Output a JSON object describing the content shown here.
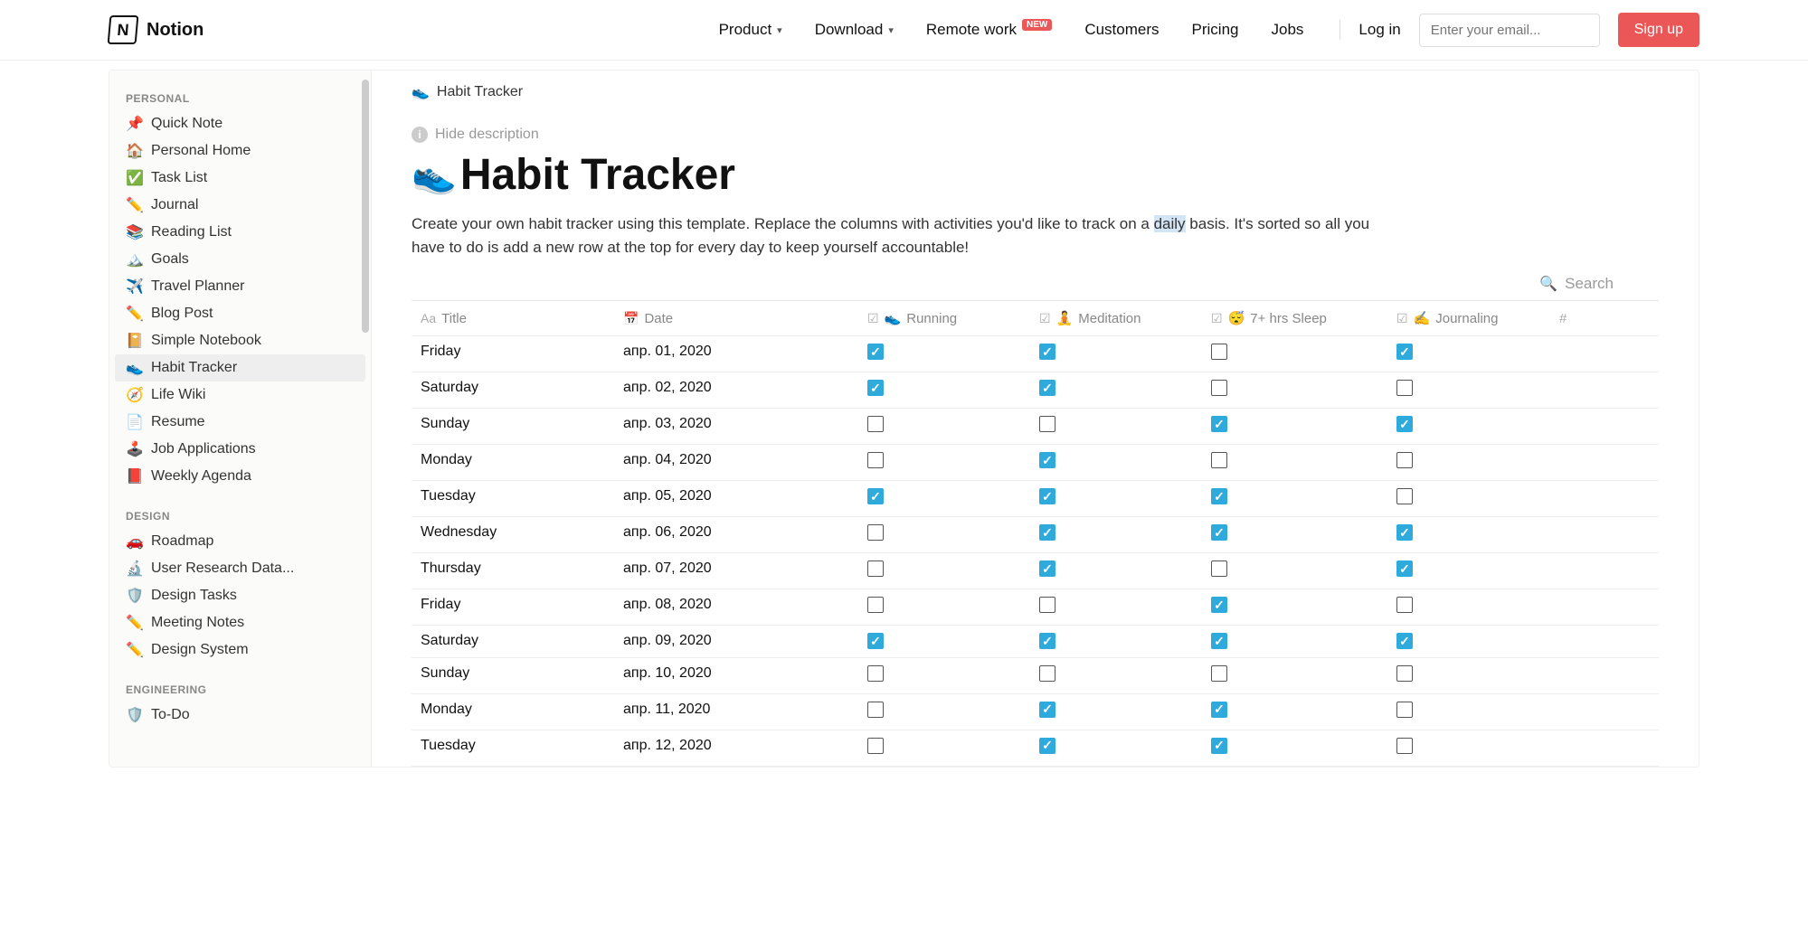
{
  "topnav": {
    "brand": "Notion",
    "links": {
      "product": "Product",
      "download": "Download",
      "remote": "Remote work",
      "remote_badge": "NEW",
      "customers": "Customers",
      "pricing": "Pricing",
      "jobs": "Jobs",
      "login": "Log in"
    },
    "email_placeholder": "Enter your email...",
    "signup": "Sign up"
  },
  "sidebar": {
    "sections": [
      {
        "title": "PERSONAL",
        "items": [
          {
            "icon": "📌",
            "label": "Quick Note"
          },
          {
            "icon": "🏠",
            "label": "Personal Home"
          },
          {
            "icon": "✅",
            "label": "Task List"
          },
          {
            "icon": "✏️",
            "label": "Journal"
          },
          {
            "icon": "📚",
            "label": "Reading List"
          },
          {
            "icon": "🏔️",
            "label": "Goals"
          },
          {
            "icon": "✈️",
            "label": "Travel Planner"
          },
          {
            "icon": "✏️",
            "label": "Blog Post"
          },
          {
            "icon": "📔",
            "label": "Simple Notebook"
          },
          {
            "icon": "👟",
            "label": "Habit Tracker",
            "active": true
          },
          {
            "icon": "🧭",
            "label": "Life Wiki"
          },
          {
            "icon": "📄",
            "label": "Resume"
          },
          {
            "icon": "🕹️",
            "label": "Job Applications"
          },
          {
            "icon": "📕",
            "label": "Weekly Agenda"
          }
        ]
      },
      {
        "title": "DESIGN",
        "items": [
          {
            "icon": "🚗",
            "label": "Roadmap"
          },
          {
            "icon": "🔬",
            "label": "User Research Data..."
          },
          {
            "icon": "🛡️",
            "label": "Design Tasks"
          },
          {
            "icon": "✏️",
            "label": "Meeting Notes"
          },
          {
            "icon": "✏️",
            "label": "Design System"
          }
        ]
      },
      {
        "title": "ENGINEERING",
        "items": [
          {
            "icon": "🛡️",
            "label": "To-Do"
          }
        ]
      }
    ]
  },
  "page": {
    "breadcrumb_icon": "👟",
    "breadcrumb": "Habit Tracker",
    "hide_desc": "Hide description",
    "title_icon": "👟",
    "title": "Habit Tracker",
    "description_pre": "Create your own habit tracker using this template. Replace the columns with activities you'd like to track on a ",
    "description_highlight": "daily",
    "description_post": " basis. It's sorted so all you have to do is add a new row at the top for every day to keep yourself accountable!",
    "search_label": "Search"
  },
  "table": {
    "columns": {
      "title": "Title",
      "date": "Date",
      "running": {
        "emoji": "👟",
        "label": "Running"
      },
      "meditation": {
        "emoji": "🧘",
        "label": "Meditation"
      },
      "sleep": {
        "emoji": "😴",
        "label": "7+ hrs Sleep"
      },
      "journaling": {
        "emoji": "✍️",
        "label": "Journaling"
      }
    },
    "rows": [
      {
        "day": "Friday",
        "date": "апр. 01, 2020",
        "running": true,
        "meditation": true,
        "sleep": false,
        "journaling": true
      },
      {
        "day": "Saturday",
        "date": "апр. 02, 2020",
        "running": true,
        "meditation": true,
        "sleep": false,
        "journaling": false
      },
      {
        "day": "Sunday",
        "date": "апр. 03, 2020",
        "running": false,
        "meditation": false,
        "sleep": true,
        "journaling": true
      },
      {
        "day": "Monday",
        "date": "апр. 04, 2020",
        "running": false,
        "meditation": true,
        "sleep": false,
        "journaling": false
      },
      {
        "day": "Tuesday",
        "date": "апр. 05, 2020",
        "running": true,
        "meditation": true,
        "sleep": true,
        "journaling": false
      },
      {
        "day": "Wednesday",
        "date": "апр. 06, 2020",
        "running": false,
        "meditation": true,
        "sleep": true,
        "journaling": true
      },
      {
        "day": "Thursday",
        "date": "апр. 07, 2020",
        "running": false,
        "meditation": true,
        "sleep": false,
        "journaling": true
      },
      {
        "day": "Friday",
        "date": "апр. 08, 2020",
        "running": false,
        "meditation": false,
        "sleep": true,
        "journaling": false
      },
      {
        "day": "Saturday",
        "date": "апр. 09, 2020",
        "running": true,
        "meditation": true,
        "sleep": true,
        "journaling": true
      },
      {
        "day": "Sunday",
        "date": "апр. 10, 2020",
        "running": false,
        "meditation": false,
        "sleep": false,
        "journaling": false
      },
      {
        "day": "Monday",
        "date": "апр. 11, 2020",
        "running": false,
        "meditation": true,
        "sleep": true,
        "journaling": false
      },
      {
        "day": "Tuesday",
        "date": "апр. 12, 2020",
        "running": false,
        "meditation": true,
        "sleep": true,
        "journaling": false
      }
    ]
  }
}
